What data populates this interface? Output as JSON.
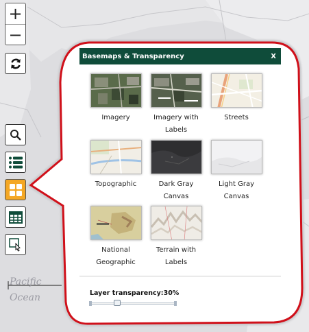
{
  "map": {
    "ocean_label_line1": "Pacific",
    "ocean_label_line2": "Ocean",
    "zoom_in": "+",
    "zoom_out": "−"
  },
  "toolbar": {
    "icons": [
      "refresh-icon",
      "search-icon",
      "list-icon",
      "basemap-gallery-icon",
      "table-icon",
      "select-icon"
    ],
    "active_color": "#f4a724"
  },
  "panel": {
    "title": "Basemaps & Transparency",
    "close_label": "X",
    "header_color": "#0f4c3a",
    "callout_border_color": "#d0101a",
    "basemaps": [
      {
        "label_line1": "Imagery",
        "label_line2": ""
      },
      {
        "label_line1": "Imagery with",
        "label_line2": "Labels"
      },
      {
        "label_line1": "Streets",
        "label_line2": ""
      },
      {
        "label_line1": "Topographic",
        "label_line2": ""
      },
      {
        "label_line1": "Dark Gray",
        "label_line2": "Canvas"
      },
      {
        "label_line1": "Light Gray",
        "label_line2": "Canvas"
      },
      {
        "label_line1": "National",
        "label_line2": "Geographic"
      },
      {
        "label_line1": "Terrain with",
        "label_line2": "Labels"
      }
    ],
    "transparency_label": "Layer transparency:30%",
    "transparency_value_percent": 30
  }
}
